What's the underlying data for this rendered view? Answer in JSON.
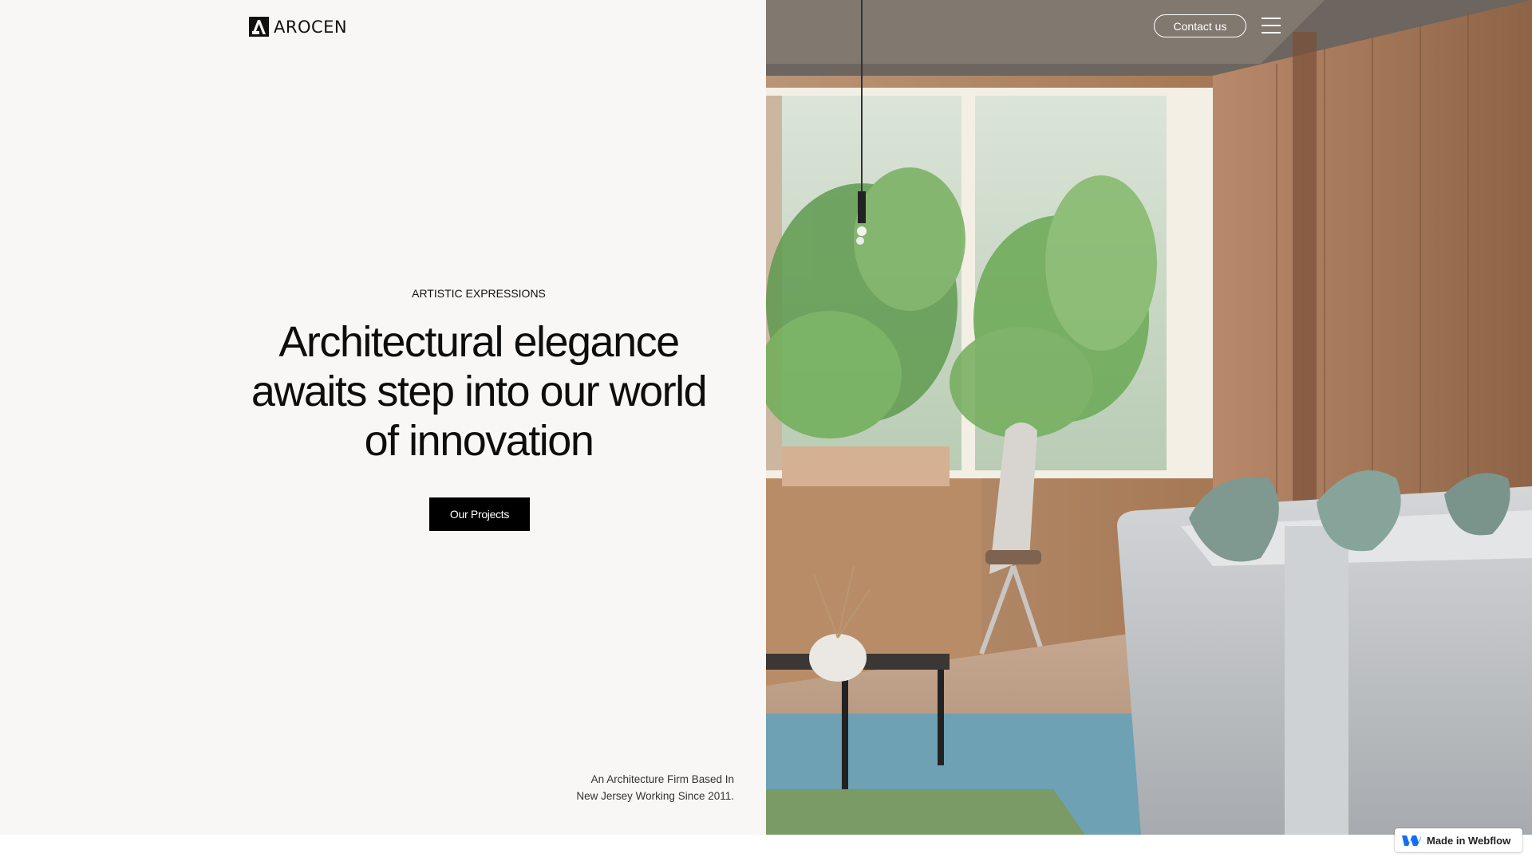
{
  "brand": {
    "name": "AROCEN",
    "logo_icon": "arocen-a-mark-icon"
  },
  "header": {
    "contact_label": "Contact us",
    "menu_icon": "hamburger-menu-icon"
  },
  "hero": {
    "eyebrow": "ARTISTIC EXPRESSIONS",
    "headline_lines": [
      "Architectural elegance",
      "awaits step into our world",
      "of innovation"
    ],
    "cta_label": "Our Projects",
    "tagline_lines": [
      "An Architecture Firm Based In",
      "New Jersey Working Since 2011."
    ],
    "image_icon": "interior-photo"
  },
  "badge": {
    "label": "Made in Webflow",
    "icon": "webflow-logo-icon"
  },
  "colors": {
    "left_bg": "#f8f7f5",
    "text": "#0d0d0d",
    "button_bg": "#000000",
    "button_text": "#ffffff",
    "webflow_blue": "#146ef5"
  }
}
